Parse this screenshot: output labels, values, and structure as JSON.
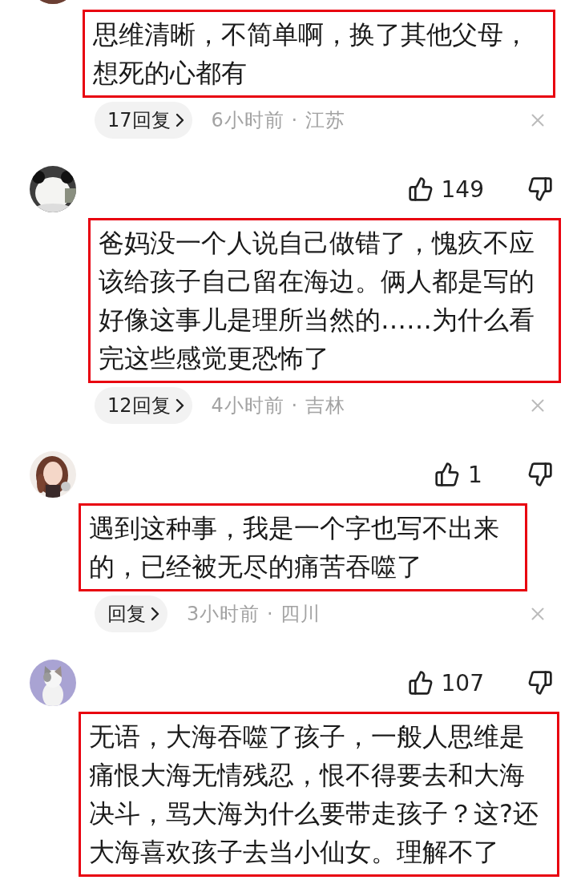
{
  "comments": [
    {
      "text": "思维清晰，不简单啊，换了其他父母，想死的心都有",
      "replies": "17回复",
      "meta": "6小时前 · 江苏"
    },
    {
      "likes": "149",
      "text": "爸妈没一个人说自己做错了，愧疚不应该给孩子自己留在海边。俩人都是写的好像这事儿是理所当然的……为什么看完这些感觉更恐怖了",
      "replies": "12回复",
      "meta": "4小时前 · 吉林"
    },
    {
      "likes": "1",
      "text": "遇到这种事，我是一个字也写不出来的，已经被无尽的痛苦吞噬了",
      "replies": "回复",
      "meta": "3小时前 · 四川"
    },
    {
      "likes": "107",
      "text": "无语，大海吞噬了孩子，一般人思维是痛恨大海无情残忍，恨不得要去和大海决斗，骂大海为什么要带走孩子？这?还大海喜欢孩子去当小仙女。理解不了"
    }
  ]
}
